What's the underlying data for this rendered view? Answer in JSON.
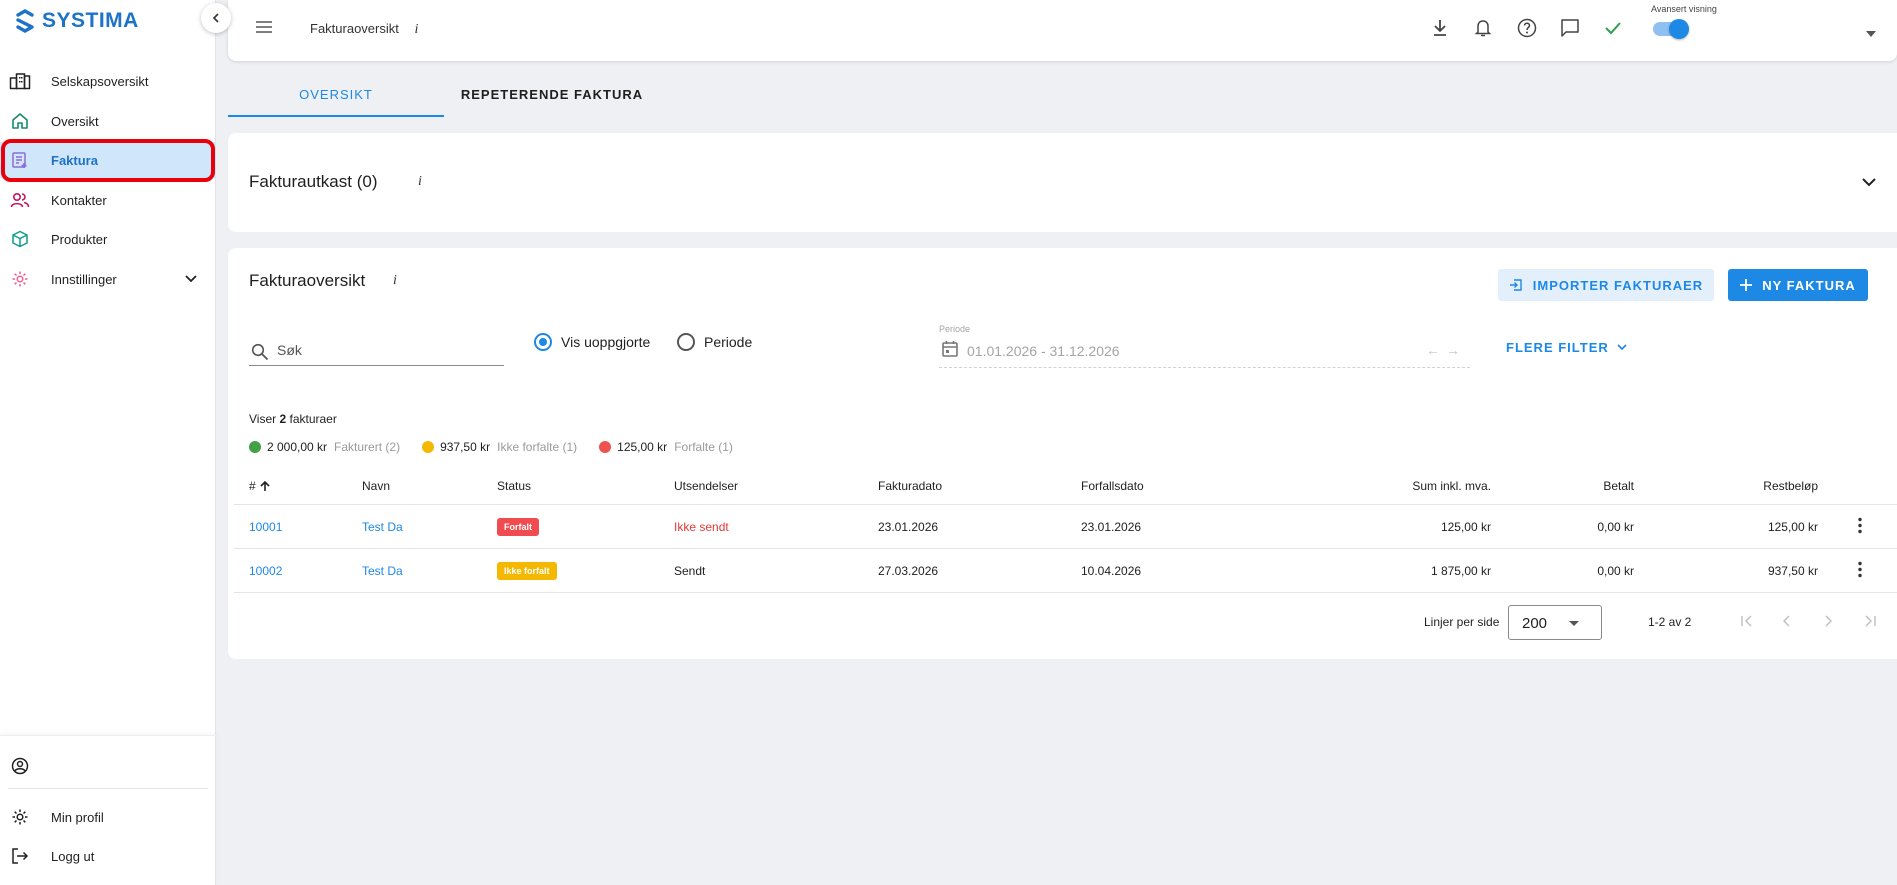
{
  "app": {
    "logo_text": "SYSTIMA"
  },
  "sidebar": {
    "items": [
      {
        "label": "Selskapsoversikt",
        "icon": "company-overview-icon"
      },
      {
        "label": "Oversikt",
        "icon": "home-icon"
      },
      {
        "label": "Faktura",
        "icon": "invoice-icon",
        "active": true
      },
      {
        "label": "Kontakter",
        "icon": "contacts-icon"
      },
      {
        "label": "Produkter",
        "icon": "product-box-icon"
      },
      {
        "label": "Innstillinger",
        "icon": "settings-gear-icon",
        "expandable": true
      }
    ],
    "bottom": [
      {
        "label": "Min profil",
        "icon": "gear-icon"
      },
      {
        "label": "Logg ut",
        "icon": "logout-icon"
      }
    ]
  },
  "topbar": {
    "title": "Fakturaoversikt",
    "info": "i",
    "toggle_label": "Avansert visning",
    "toggle_on": true
  },
  "tabs": [
    {
      "label": "OVERSIKT",
      "active": true
    },
    {
      "label": "REPETERENDE FAKTURA",
      "active": false
    }
  ],
  "drafts": {
    "title": "Fakturautkast (0)",
    "info": "i"
  },
  "overview": {
    "title": "Fakturaoversikt",
    "info": "i",
    "import_button": "IMPORTER FAKTURAER",
    "new_button": "NY FAKTURA",
    "search_placeholder": "Søk",
    "radio_unsettled": "Vis uoppgjorte",
    "radio_period": "Periode",
    "period_label": "Periode",
    "period_value": "01.01.2026 - 31.12.2026",
    "more_filters": "FLERE FILTER",
    "summary_prefix": "Viser",
    "summary_count": "2",
    "summary_suffix": "fakturaer",
    "legend": [
      {
        "amount": "2 000,00 kr",
        "label": "Fakturert (2)",
        "color": "#43a047"
      },
      {
        "amount": "937,50 kr",
        "label": "Ikke forfalte (1)",
        "color": "#f5b800"
      },
      {
        "amount": "125,00 kr",
        "label": "Forfalte (1)",
        "color": "#ef5350"
      }
    ]
  },
  "table": {
    "headers": {
      "number": "#",
      "name": "Navn",
      "status": "Status",
      "sendings": "Utsendelser",
      "invoice_date": "Fakturadato",
      "due_date": "Forfallsdato",
      "sum": "Sum inkl. mva.",
      "paid": "Betalt",
      "remaining": "Restbeløp"
    },
    "rows": [
      {
        "number": "10001",
        "name": "Test Da",
        "status": "Forfalt",
        "sendings": "Ikke sendt",
        "invoice_date": "23.01.2026",
        "due_date": "23.01.2026",
        "sum": "125,00 kr",
        "paid": "0,00 kr",
        "remaining": "125,00 kr"
      },
      {
        "number": "10002",
        "name": "Test Da",
        "status": "Ikke forfalt",
        "sendings": "Sendt",
        "invoice_date": "27.03.2026",
        "due_date": "10.04.2026",
        "sum": "1 875,00 kr",
        "paid": "0,00 kr",
        "remaining": "937,50 kr"
      }
    ]
  },
  "pagination": {
    "rows_per_page_label": "Linjer per side",
    "rows_per_page_value": "200",
    "range": "1-2 av 2"
  }
}
